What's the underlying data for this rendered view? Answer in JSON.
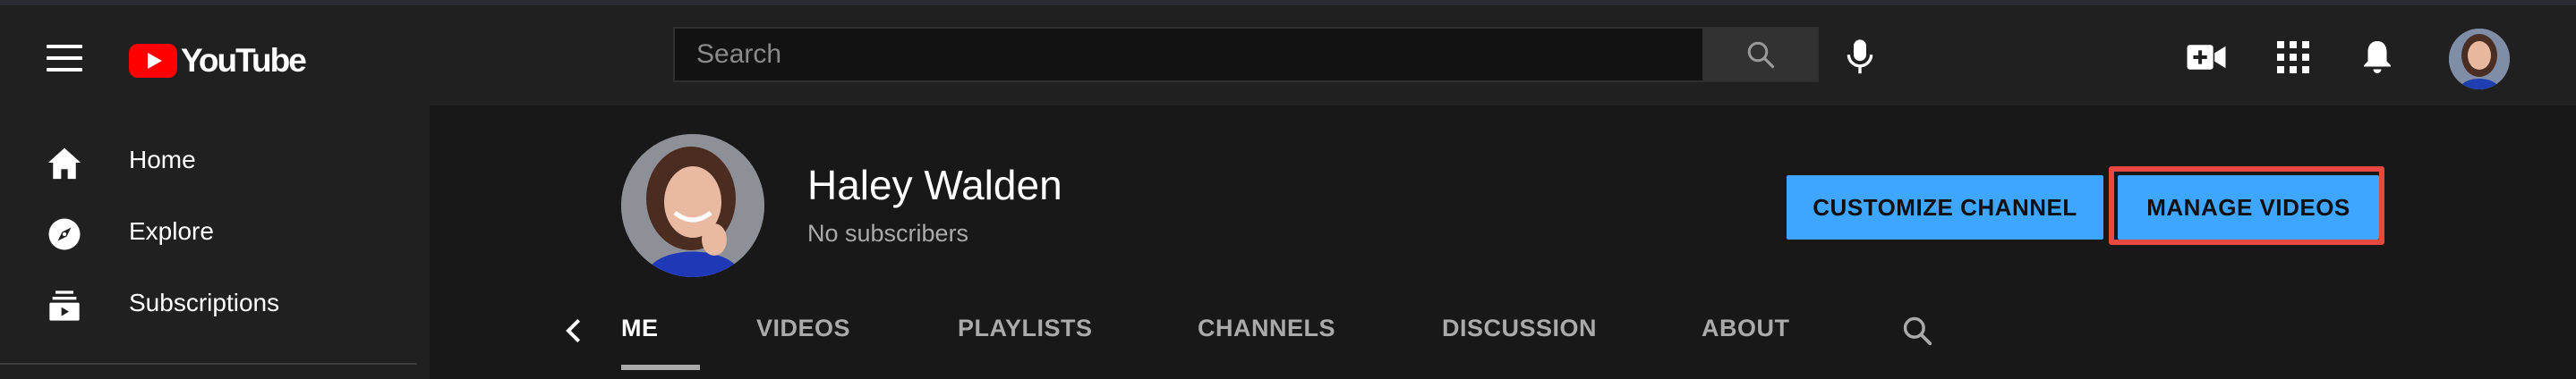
{
  "header": {
    "logo_text": "YouTube",
    "search_placeholder": "Search"
  },
  "sidebar": {
    "items": [
      {
        "label": "Home",
        "icon": "home-icon"
      },
      {
        "label": "Explore",
        "icon": "compass-icon"
      },
      {
        "label": "Subscriptions",
        "icon": "subscriptions-icon"
      }
    ]
  },
  "channel": {
    "name": "Haley Walden",
    "subscribers": "No subscribers",
    "customize_label": "CUSTOMIZE CHANNEL",
    "manage_label": "MANAGE VIDEOS"
  },
  "tabs": [
    {
      "label": "ME",
      "active": true
    },
    {
      "label": "VIDEOS",
      "active": false
    },
    {
      "label": "PLAYLISTS",
      "active": false
    },
    {
      "label": "CHANNELS",
      "active": false
    },
    {
      "label": "DISCUSSION",
      "active": false
    },
    {
      "label": "ABOUT",
      "active": false
    }
  ],
  "colors": {
    "accent": "#3ea6ff",
    "brand": "#ff0000",
    "highlight": "#e8483f"
  }
}
